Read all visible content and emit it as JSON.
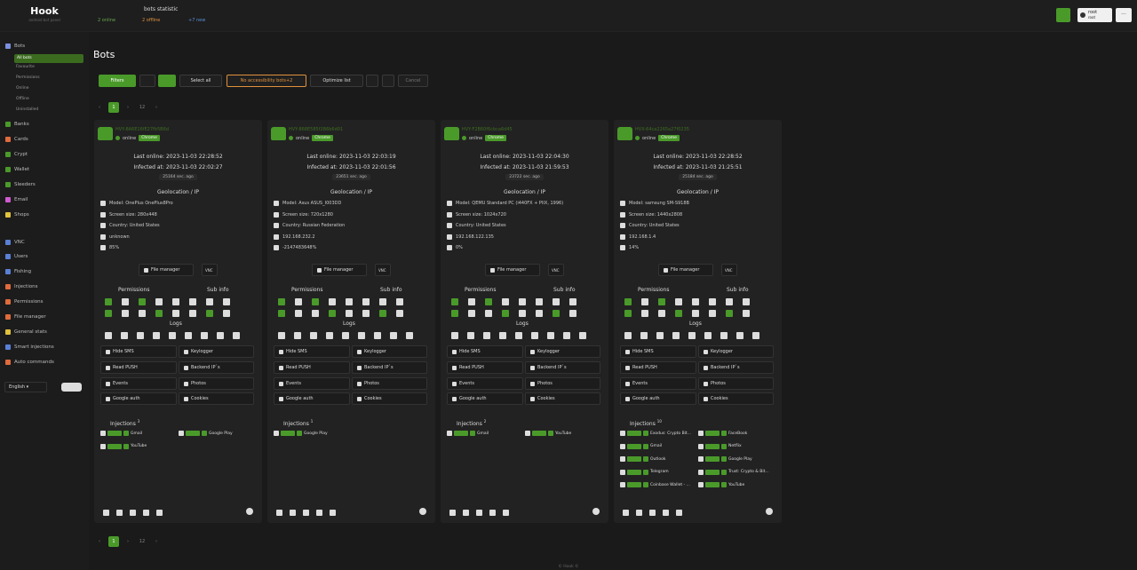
{
  "app": {
    "title": "Hook",
    "subtitle": "android bot panel",
    "stats_title": "bots statistic",
    "online": "2 online",
    "offline": "2 offline",
    "new": "+7 new",
    "user": "root",
    "user_sub": "root"
  },
  "sidebar": {
    "items": [
      {
        "label": "Bots",
        "color": "#7b8fe0"
      },
      {
        "label": "Banks",
        "color": "#4a9a2a"
      },
      {
        "label": "Cards",
        "color": "#e06b3d"
      },
      {
        "label": "Crypt",
        "color": "#4a9a2a"
      },
      {
        "label": "Wallet",
        "color": "#4a9a2a"
      },
      {
        "label": "Sleeders",
        "color": "#4a9a2a"
      },
      {
        "label": "Email",
        "color": "#d05bd0"
      },
      {
        "label": "Shops",
        "color": "#e0c23d"
      },
      {
        "label": "VNC",
        "color": "#5a7fd6"
      },
      {
        "label": "Users",
        "color": "#5a7fd6"
      },
      {
        "label": "Fishing",
        "color": "#5a7fd6"
      },
      {
        "label": "Injections",
        "color": "#e06b3d"
      },
      {
        "label": "Permissions",
        "color": "#e06b3d"
      },
      {
        "label": "File manager",
        "color": "#e06b3d"
      },
      {
        "label": "General stats",
        "color": "#e0c23d"
      },
      {
        "label": "Smart injections",
        "color": "#5a7fd6"
      },
      {
        "label": "Auto commands",
        "color": "#e06b3d"
      }
    ],
    "sub_items": [
      "All bots",
      "Favourite",
      "Permissions",
      "Online",
      "Offline",
      "Uninstalled"
    ],
    "language": "English"
  },
  "main": {
    "title": "Bots"
  },
  "toolbar": {
    "filters": "Filters",
    "select_all": "Select all",
    "no_access": "No accessibility bots+2",
    "optimize": "Optimize list",
    "cancel": "Cancel"
  },
  "pager": {
    "current": "1",
    "last": "12"
  },
  "labels": {
    "geo": "Geolocation / IP",
    "file_manager": "File manager",
    "vnc": "VNC",
    "permissions": "Permissions",
    "subinfo": "Sub info",
    "logs": "Logs",
    "hide_sms": "Hide SMS",
    "keylogger": "Keylogger",
    "read_push": "Read PUSH",
    "backend_ip": "Backend IP`s",
    "events": "Events",
    "photos": "Photos",
    "google_auth": "Google auth",
    "cookies": "Cookies",
    "injections": "Injections"
  },
  "bots": [
    {
      "id": "HVY-8A6E16fE27fb5B6d",
      "status": "online",
      "badge": "Chrome",
      "last": "Last online: 2023-11-03 22:28:52",
      "infected": "Infected at: 2023-11-03 22:02:27",
      "ago": "25164 sec. ago",
      "model": "Model: OnePlus OnePlus8Pro",
      "screen": "Screen size: 280x448",
      "country": "Country: United States",
      "ip": "unknown",
      "battery": "85%",
      "inj_count": "3",
      "inj": [
        "Gmail",
        "Google Play",
        "YouTube"
      ]
    },
    {
      "id": "HVY-868E585f2B6b6d01",
      "status": "online",
      "badge": "Chrome",
      "last": "Last online: 2023-11-03 22:03:19",
      "infected": "Infected at: 2023-11-03 22:01:56",
      "ago": "23651 sec. ago",
      "model": "Model: Asus ASUS_I003DD",
      "screen": "Screen size: 720x1280",
      "country": "Country: Russian Federation",
      "ip": "192.168.232.2",
      "battery": "-2147483648%",
      "inj_count": "1",
      "inj": [
        "Google Play"
      ]
    },
    {
      "id": "HVY-F2B60f6cbca6d45",
      "status": "online",
      "badge": "Chrome",
      "last": "Last online: 2023-11-03 22:04:30",
      "infected": "Infected at: 2023-11-03 21:59:53",
      "ago": "23722 sec. ago",
      "model": "Model: QEMU Standard PC (i440FX + PIIX, 1996)",
      "screen": "Screen size: 1024x720",
      "country": "Country: United States",
      "ip": "192.168.122.135",
      "battery": "0%",
      "inj_count": "2",
      "inj": [
        "Gmail",
        "YouTube"
      ]
    },
    {
      "id": "HVX-64ca2265a27f0235",
      "status": "online",
      "badge": "Chrome",
      "last": "Last online: 2023-11-03 22:28:52",
      "infected": "Infected at: 2023-11-03 21:25:51",
      "ago": "25184 sec. ago",
      "model": "Model: samsung SM-S918B",
      "screen": "Screen size: 1440x2808",
      "country": "Country: United States",
      "ip": "192.168.1.4",
      "battery": "14%",
      "inj_count": "10",
      "inj": [
        "Exodus: Crypto Bit...",
        "FaceBook",
        "Gmail",
        "Netflix",
        "Outlook",
        "Google Play",
        "Telegram",
        "Trust: Crypto & Bit...",
        "Coinbase Wallet - ...",
        "YouTube"
      ]
    }
  ],
  "footer": "© Hook ©"
}
